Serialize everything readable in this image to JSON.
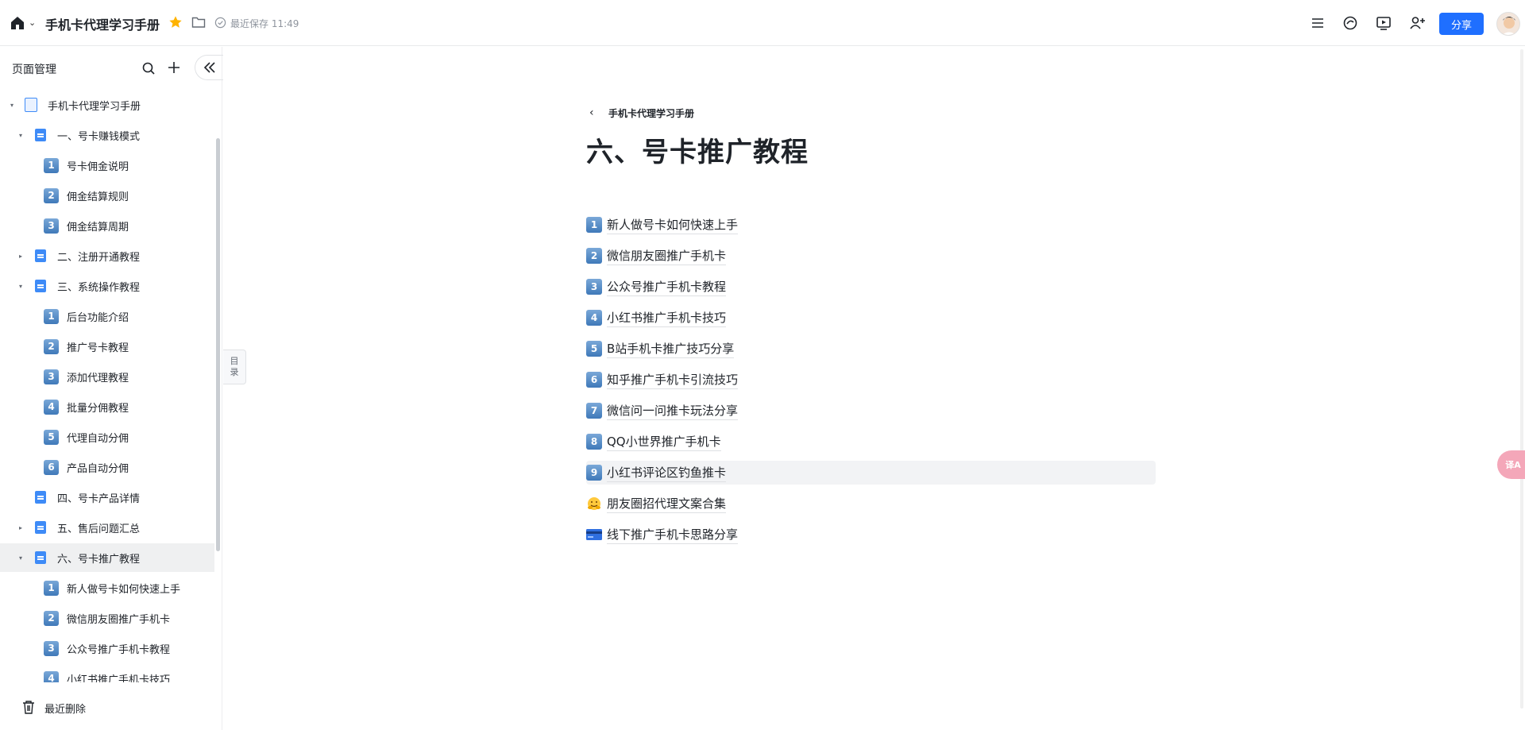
{
  "topbar": {
    "title": "手机卡代理学习手册",
    "saved_text": "最近保存 11:49",
    "share_label": "分享",
    "icons": [
      "home-icon",
      "star-icon",
      "folder-icon",
      "outline-icon",
      "comment-icon",
      "present-icon",
      "add-user-icon"
    ]
  },
  "sidebar": {
    "header": "页面管理",
    "tree": [
      {
        "label": "手机卡代理学习手册",
        "level": 0,
        "icon": "root",
        "caret": "down"
      },
      {
        "label": "一、号卡赚钱模式",
        "level": 1,
        "icon": "doc",
        "caret": "down"
      },
      {
        "label": "号卡佣金说明",
        "level": 2,
        "icon": "1"
      },
      {
        "label": "佣金结算规则",
        "level": 2,
        "icon": "2"
      },
      {
        "label": "佣金结算周期",
        "level": 2,
        "icon": "3"
      },
      {
        "label": "二、注册开通教程",
        "level": 1,
        "icon": "doc",
        "caret": "right"
      },
      {
        "label": "三、系统操作教程",
        "level": 1,
        "icon": "doc",
        "caret": "down"
      },
      {
        "label": "后台功能介绍",
        "level": 2,
        "icon": "1"
      },
      {
        "label": "推广号卡教程",
        "level": 2,
        "icon": "2"
      },
      {
        "label": "添加代理教程",
        "level": 2,
        "icon": "3"
      },
      {
        "label": "批量分佣教程",
        "level": 2,
        "icon": "4"
      },
      {
        "label": "代理自动分佣",
        "level": 2,
        "icon": "5"
      },
      {
        "label": "产品自动分佣",
        "level": 2,
        "icon": "6"
      },
      {
        "label": "四、号卡产品详情",
        "level": 1,
        "icon": "doc"
      },
      {
        "label": "五、售后问题汇总",
        "level": 1,
        "icon": "doc",
        "caret": "right"
      },
      {
        "label": "六、号卡推广教程",
        "level": 1,
        "icon": "doc",
        "caret": "down",
        "selected": true
      },
      {
        "label": "新人做号卡如何快速上手",
        "level": 2,
        "icon": "1"
      },
      {
        "label": "微信朋友圈推广手机卡",
        "level": 2,
        "icon": "2"
      },
      {
        "label": "公众号推广手机卡教程",
        "level": 2,
        "icon": "3"
      },
      {
        "label": "小红书推广手机卡技巧",
        "level": 2,
        "icon": "4"
      }
    ],
    "footer_label": "最近删除"
  },
  "toc_tab": {
    "line1": "目",
    "line2": "录"
  },
  "main": {
    "breadcrumb": "手机卡代理学习手册",
    "title": "六、号卡推广教程",
    "links": [
      {
        "icon": "1",
        "label": "新人做号卡如何快速上手"
      },
      {
        "icon": "2",
        "label": "微信朋友圈推广手机卡"
      },
      {
        "icon": "3",
        "label": "公众号推广手机卡教程"
      },
      {
        "icon": "4",
        "label": "小红书推广手机卡技巧"
      },
      {
        "icon": "5",
        "label": "B站手机卡推广技巧分享"
      },
      {
        "icon": "6",
        "label": "知乎推广手机卡引流技巧"
      },
      {
        "icon": "7",
        "label": "微信问一问推卡玩法分享"
      },
      {
        "icon": "8",
        "label": "QQ小世界推广手机卡"
      },
      {
        "icon": "9",
        "label": "小红书评论区钓鱼推卡",
        "hover": true
      },
      {
        "icon": "hug-emoji",
        "label": "朋友圈招代理文案合集"
      },
      {
        "icon": "card-emoji",
        "label": "线下推广手机卡思路分享"
      }
    ]
  },
  "float_pill": "译A"
}
